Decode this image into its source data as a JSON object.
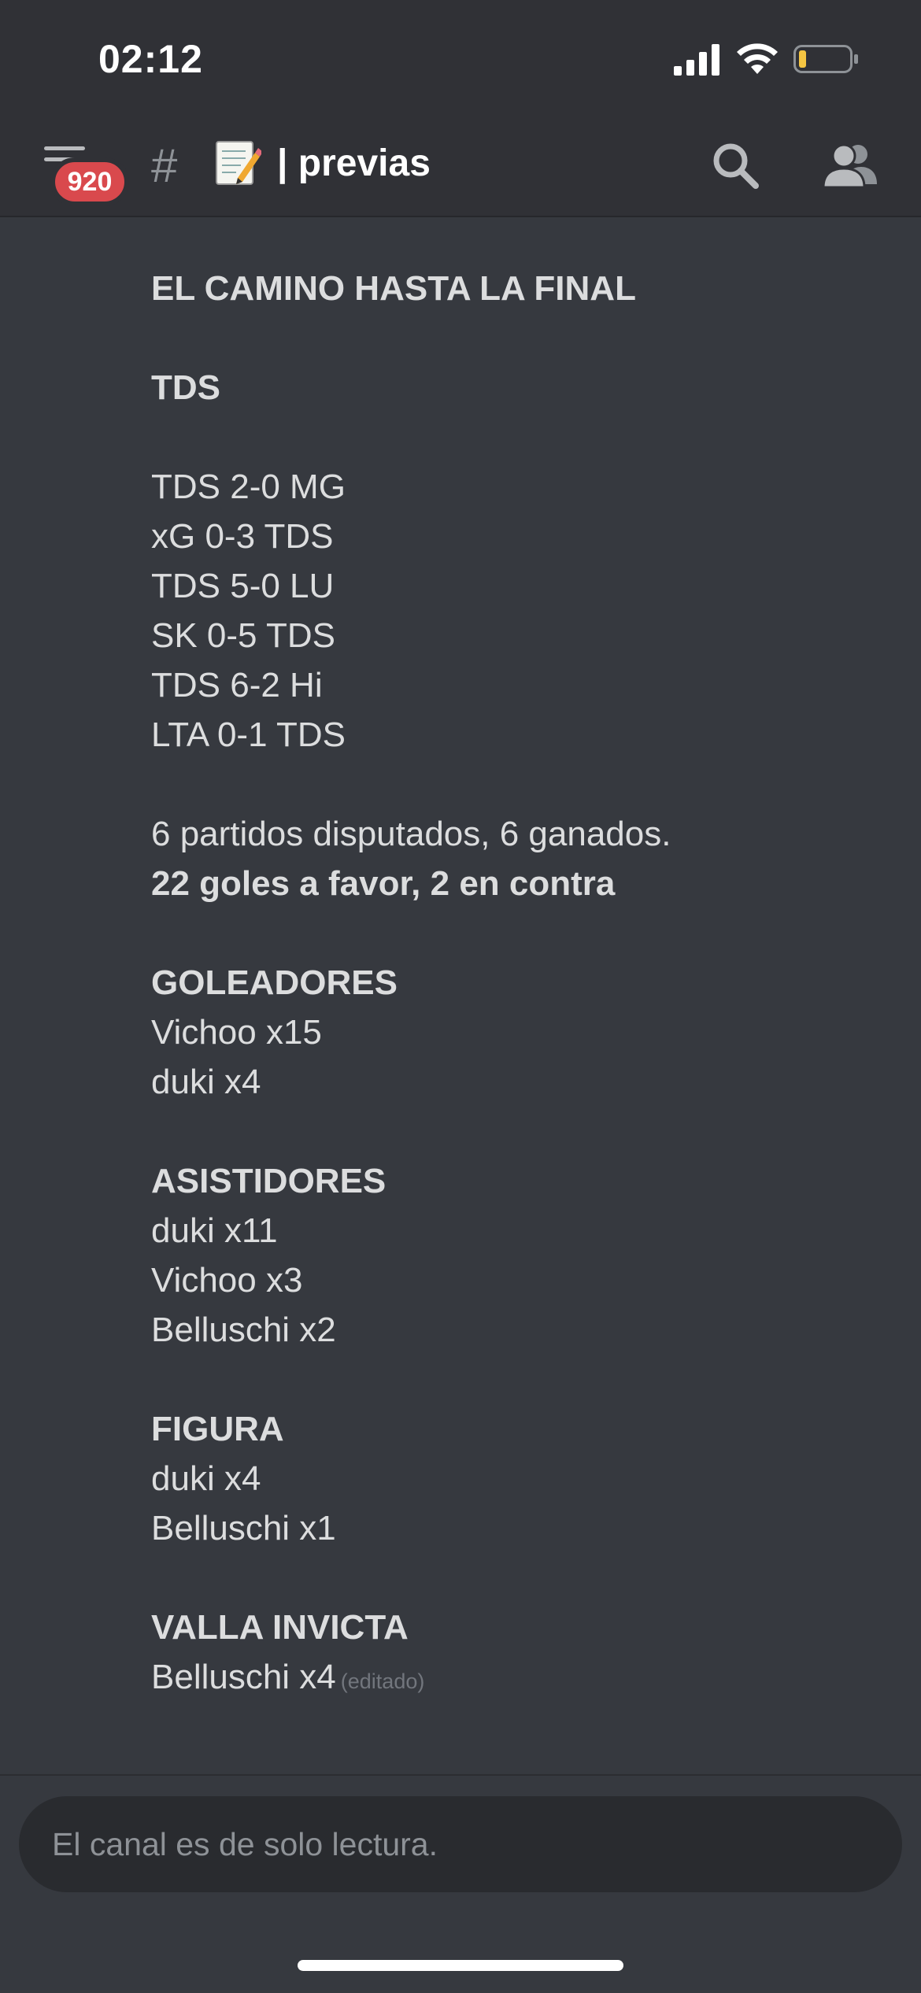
{
  "status_bar": {
    "time": "02:12"
  },
  "header": {
    "badge_count": "920",
    "channel_prefix": "#",
    "channel_name": "| previas",
    "icons": [
      "menu-icon",
      "hash-icon",
      "memo-icon",
      "search-icon",
      "members-icon"
    ]
  },
  "message": {
    "title": "EL CAMINO HASTA LA FINAL",
    "team_heading": "TDS",
    "results": [
      "TDS 2-0 MG",
      "xG 0-3 TDS",
      "TDS 5-0 LU",
      "SK 0-5 TDS",
      "TDS 6-2 Hi",
      "LTA 0-1 TDS"
    ],
    "summary_line": "6 partidos disputados, 6 ganados.",
    "goals_line": "22 goles a favor, 2 en contra",
    "scorers_heading": "GOLEADORES",
    "scorers": [
      "Vichoo x15",
      "duki x4"
    ],
    "assists_heading": "ASISTIDORES",
    "assists": [
      "duki x11",
      "Vichoo x3",
      "Belluschi x2"
    ],
    "figure_heading": "FIGURA",
    "figure": [
      "duki x4",
      "Belluschi x1"
    ],
    "cleansheet_heading": "VALLA INVICTA",
    "cleansheet": [
      "Belluschi x4"
    ],
    "edited_label": "(editado)"
  },
  "input": {
    "readonly_text": "El canal es de solo lectura."
  },
  "colors": {
    "background": "#36393f",
    "header_bg": "#303136",
    "badge": "#d9494d",
    "text": "#dcddde",
    "muted": "#8e9297"
  }
}
